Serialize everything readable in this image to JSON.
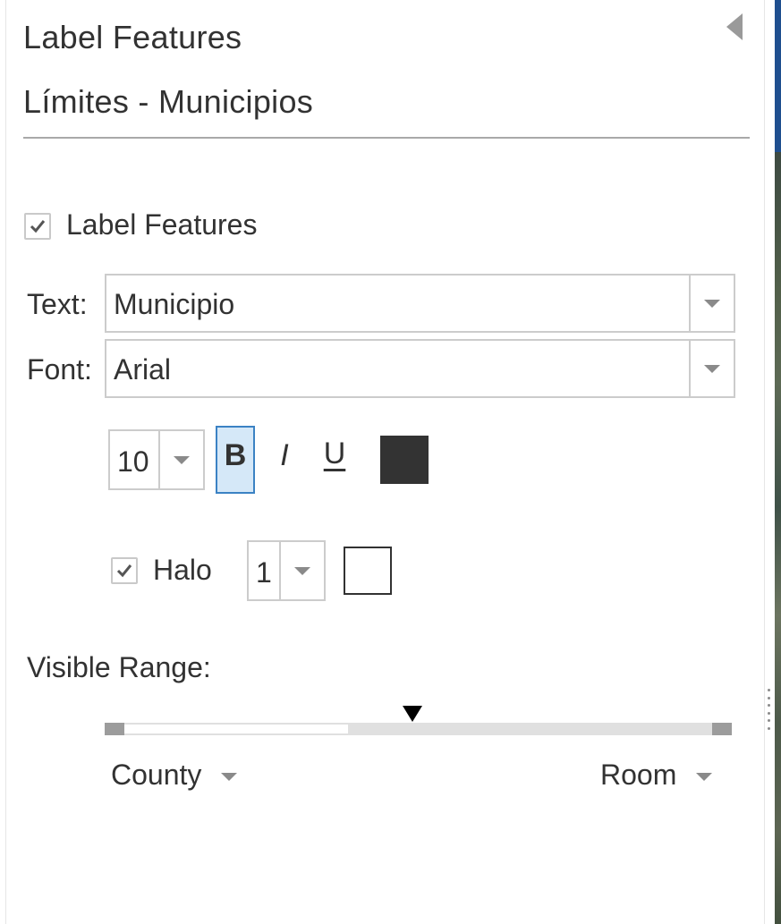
{
  "panel": {
    "title": "Label Features",
    "layer_name": "Límites - Municipios",
    "collapse_icon": "chevron-left-icon"
  },
  "label_toggle": {
    "label": "Label Features",
    "checked": true
  },
  "text_field": {
    "label": "Text:",
    "value": "Municipio"
  },
  "font_field": {
    "label": "Font:",
    "value": "Arial"
  },
  "font_style": {
    "size": "10",
    "bold_label": "B",
    "bold_active": true,
    "italic_label": "I",
    "italic_active": false,
    "underline_label": "U",
    "underline_active": false,
    "font_color": "#333333"
  },
  "halo": {
    "label": "Halo",
    "checked": true,
    "size": "1",
    "color": "#ffffff"
  },
  "visible_range": {
    "label": "Visible Range:",
    "min_scale": "County",
    "max_scale": "Room",
    "current_fraction": 0.49,
    "range_start_fraction": 0.0,
    "range_end_fraction": 0.38
  },
  "colors": {
    "accent": "#3b82c4",
    "bold_active_bg": "#d5e8f8",
    "border": "#cccccc",
    "text": "#323232"
  }
}
